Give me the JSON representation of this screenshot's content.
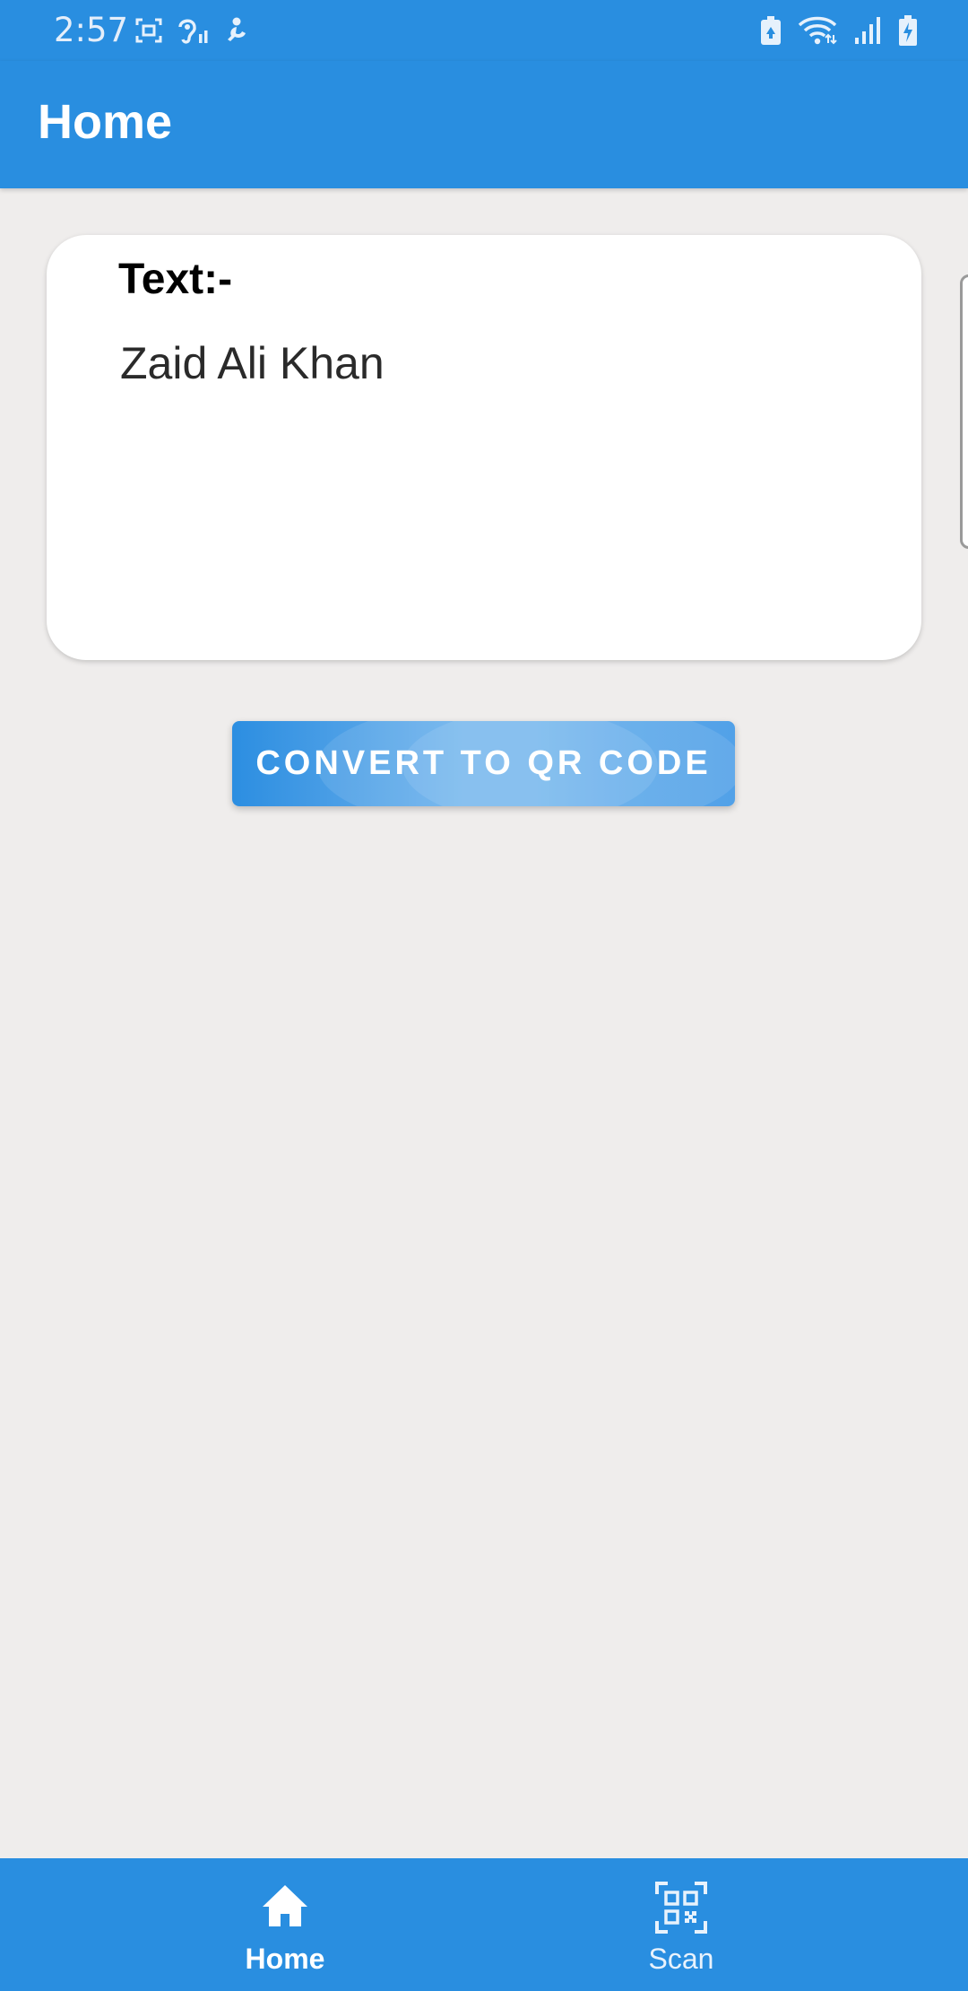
{
  "status_bar": {
    "time": "2:57",
    "left_icons": [
      "screenshot-icon",
      "hearing-icon",
      "accessibility-icon"
    ],
    "right_icons": [
      "battery-saver-icon",
      "wifi-icon",
      "signal-icon",
      "battery-charging-icon"
    ]
  },
  "app_bar": {
    "title": "Home"
  },
  "card": {
    "label": "Text:-",
    "input_value": "Zaid Ali Khan"
  },
  "convert_button": {
    "label": "CONVERT TO QR CODE"
  },
  "bottom_nav": {
    "items": [
      {
        "label": "Home",
        "icon": "home-icon",
        "active": true
      },
      {
        "label": "Scan",
        "icon": "qr-scan-icon",
        "active": false
      }
    ]
  },
  "colors": {
    "primary": "#298ee0",
    "background": "#efedec",
    "card": "#ffffff"
  }
}
